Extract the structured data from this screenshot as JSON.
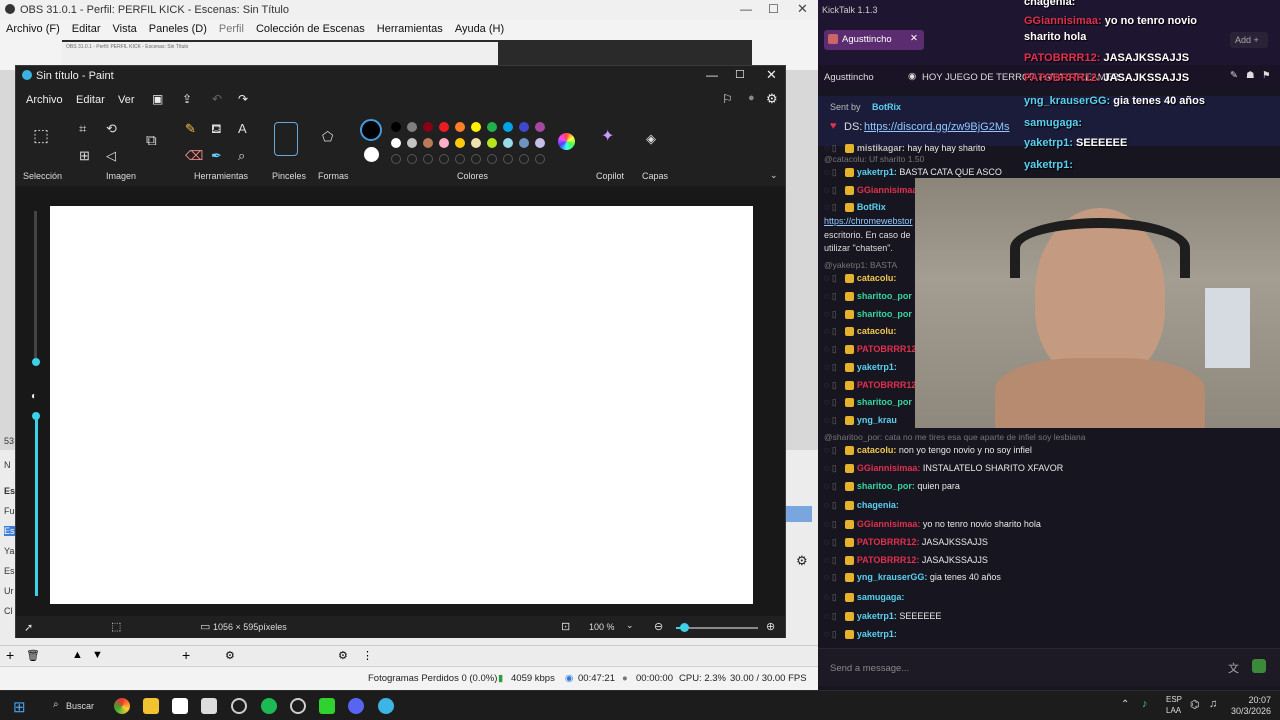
{
  "obs": {
    "title": "OBS 31.0.1 - Perfil: PERFIL KICK - Escenas: Sin Título",
    "menu": [
      "Archivo (F)",
      "Editar",
      "Vista",
      "Paneles (D)",
      "Perfil",
      "Colección de Escenas",
      "Herramientas",
      "Ayuda (H)"
    ],
    "status": {
      "dropped": "Fotogramas Perdidos 0 (0.0%)",
      "bitrate": "4059 kbps",
      "live_time": "00:47:21",
      "rec_time": "00:00:00",
      "cpu": "CPU: 2.3%",
      "fps": "30.00 / 30.00 FPS"
    },
    "preview_text": "OBS 31.0.1 - Perfil: PERFIL KICK - Escenas: Sin Título",
    "left_labels": [
      "53",
      "N",
      "Es",
      "Fu",
      "Es",
      "Ya",
      "Es",
      "Ur",
      "Cl"
    ]
  },
  "paint": {
    "title": "Sin título - Paint",
    "menu": [
      "Archivo",
      "Editar",
      "Ver"
    ],
    "groups": [
      "Selección",
      "Imagen",
      "Herramientas",
      "Pinceles",
      "Formas",
      "Colores",
      "Copilot",
      "Capas"
    ],
    "status_size": "1056 × 595píxeles",
    "zoom": "100 %",
    "palette_row1": [
      "#000000",
      "#7f7f7f",
      "#880015",
      "#ed1c24",
      "#ff7f27",
      "#fff200",
      "#22b14c",
      "#00a2e8",
      "#3f48cc",
      "#a349a4"
    ],
    "palette_row2": [
      "#ffffff",
      "#c3c3c3",
      "#b97a57",
      "#ffaec9",
      "#ffc90e",
      "#efe4b0",
      "#b5e61d",
      "#99d9ea",
      "#7092be",
      "#c8bfe7"
    ]
  },
  "taskbar": {
    "search": "Buscar",
    "lang": "ESP",
    "lang2": "LAA",
    "time": "20:07",
    "date": "30/3/2026"
  },
  "kick": {
    "title": "KickTalk 1.1.3",
    "tab": "Agusttincho",
    "channel": "Agusttincho",
    "stream_title": "HOY JUEGO DE TERROR PARA STREAMER",
    "add": "Add",
    "pinned_by": "Sent by",
    "pinned_user": "BotRix",
    "pinned_msg": "DS:",
    "pinned_link": "https://discord.gg/zw9BjG2Ms",
    "input_placeholder": "Send a message...",
    "messages": [
      {
        "user": "mistikagar:",
        "text": "hay hay hay sharito",
        "color": "#bbbbbb"
      },
      {
        "user": "yaketrp1:",
        "text": "BASTA CATA QUE ASCO",
        "color": "#5ad1f0"
      },
      {
        "user": "GGiannisimaa:",
        "text": "",
        "color": "#e0304e"
      },
      {
        "user": "BotRix",
        "text": "",
        "color": "#5ad1f0"
      },
      {
        "user": "catacolu:",
        "text": "",
        "color": "#f2c94c"
      },
      {
        "user": "sharitoo_por",
        "text": "",
        "color": "#35d5a0"
      },
      {
        "user": "sharitoo_por",
        "text": "",
        "color": "#35d5a0"
      },
      {
        "user": "catacolu:",
        "text": "",
        "color": "#f2c94c"
      },
      {
        "user": "PATOBRRR12",
        "text": "",
        "color": "#e0304e"
      },
      {
        "user": "yaketrp1:",
        "text": "",
        "color": "#5ad1f0"
      },
      {
        "user": "PATOBRRR12",
        "text": "",
        "color": "#e0304e"
      },
      {
        "user": "sharitoo_por",
        "text": "",
        "color": "#35d5a0"
      },
      {
        "user": "yng_krau",
        "text": "",
        "color": "#5ad1f0"
      },
      {
        "user": "catacolu:",
        "text": "non yo tengo novio y no soy infiel",
        "color": "#f2c94c"
      },
      {
        "user": "GGiannisimaa:",
        "text": "INSTALATELO SHARITO XFAVOR",
        "color": "#e0304e"
      },
      {
        "user": "sharitoo_por:",
        "text": "quien para",
        "color": "#35d5a0"
      },
      {
        "user": "chagenia:",
        "text": "",
        "color": "#5ad1f0"
      },
      {
        "user": "GGiannisimaa:",
        "text": "yo no tenro novio sharito hola",
        "color": "#e0304e"
      },
      {
        "user": "PATOBRRR12:",
        "text": "JASAJKSSAJJS",
        "color": "#e0304e"
      },
      {
        "user": "PATOBRRR12:",
        "text": "JASAJKSSAJJS",
        "color": "#e0304e"
      },
      {
        "user": "yng_krauserGG:",
        "text": "gia tenes 40 años",
        "color": "#5ad1f0"
      },
      {
        "user": "samugaga:",
        "text": "",
        "color": "#5ad1f0"
      },
      {
        "user": "yaketrp1:",
        "text": "SEEEEEE",
        "color": "#5ad1f0"
      },
      {
        "user": "yaketrp1:",
        "text": "",
        "color": "#5ad1f0"
      }
    ],
    "sys_lines": [
      "@catacolu: Uf sharito 1.50",
      "@yaketrp1: BASTA",
      "@sharitoo_por: cata no me tires esa que aparte de infiel soy lesbiana"
    ],
    "botrix_lines": [
      "https://chromewebstor",
      "escritorio. En caso de",
      "utilizar \"chatsen\"."
    ]
  },
  "overlay": {
    "rows": [
      {
        "user": "chagenia:",
        "text": "",
        "color": "#ffffff"
      },
      {
        "user": "GGiannisimaa:",
        "text": "yo no tenro novio",
        "color": "#e0304e"
      },
      {
        "user": "",
        "text": "sharito hola",
        "color": "#ffffff"
      },
      {
        "user": "PATOBRRR12:",
        "text": "JASAJKSSAJJS",
        "color": "#e0304e"
      },
      {
        "user": "PATOBRRR12:",
        "text": "JASAJKSSAJJS",
        "color": "#e0304e"
      },
      {
        "user": "yng_krauserGG:",
        "text": "gia tenes 40 años",
        "color": "#5ad1f0"
      },
      {
        "user": "samugaga:",
        "text": "",
        "color": "#5ad1f0"
      },
      {
        "user": "yaketrp1:",
        "text": "SEEEEEE",
        "color": "#5ad1f0"
      },
      {
        "user": "yaketrp1:",
        "text": "",
        "color": "#5ad1f0"
      }
    ]
  }
}
